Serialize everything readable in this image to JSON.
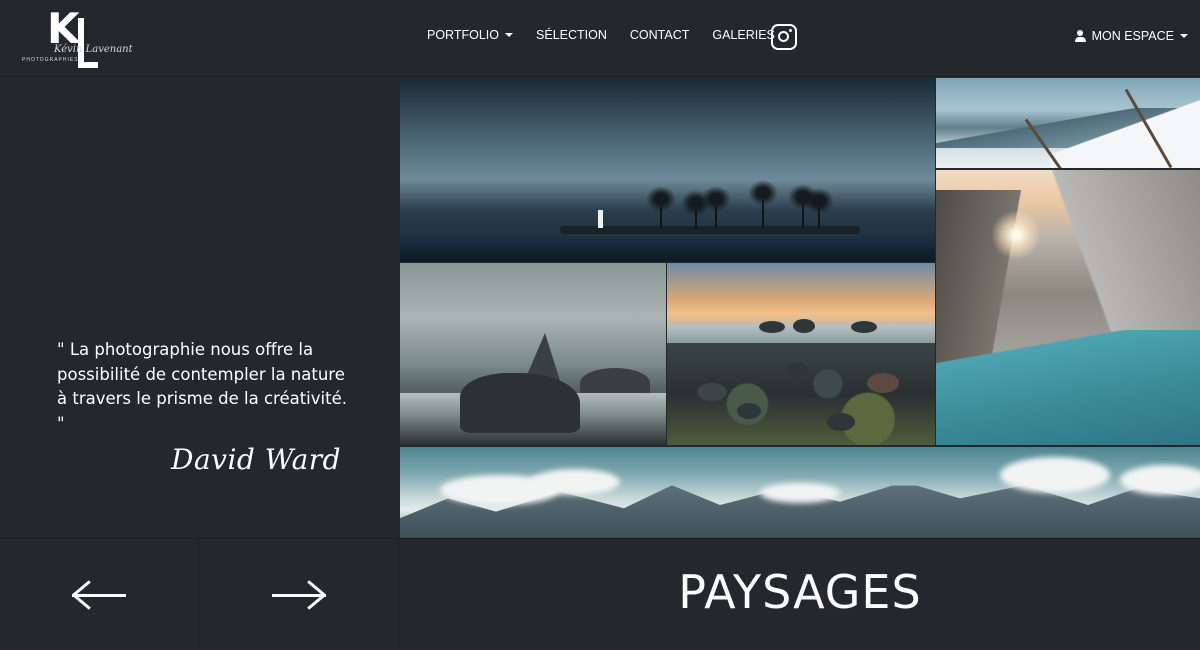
{
  "logo": {
    "monogram": "K",
    "script": "Kévin Lavenant",
    "subtitle": "PHOTOGRAPHIES"
  },
  "nav": {
    "items": [
      {
        "label": "PORTFOLIO",
        "dropdown": true
      },
      {
        "label": "SÉLECTION",
        "dropdown": false
      },
      {
        "label": "CONTACT",
        "dropdown": false
      },
      {
        "label": "GALERIES",
        "dropdown": false
      }
    ],
    "instagram_icon": "instagram-icon"
  },
  "account": {
    "label": "MON ESPACE",
    "icon": "user-icon"
  },
  "quote": {
    "text": "\" La photographie nous offre la possibilité de contempler la nature à travers le prisme de la créativité. \"",
    "author": "David Ward"
  },
  "gallery": {
    "images": [
      "storm-lake",
      "snowy-branch",
      "sea-rocks",
      "pebble-beach-sunset",
      "canyon-lake",
      "mountain-panorama"
    ]
  },
  "footer": {
    "prev_icon": "arrow-left-icon",
    "next_icon": "arrow-right-icon",
    "title": "PAYSAGES"
  },
  "colors": {
    "background": "#24272c",
    "text": "#ffffff",
    "divider": "#1b1d21"
  }
}
